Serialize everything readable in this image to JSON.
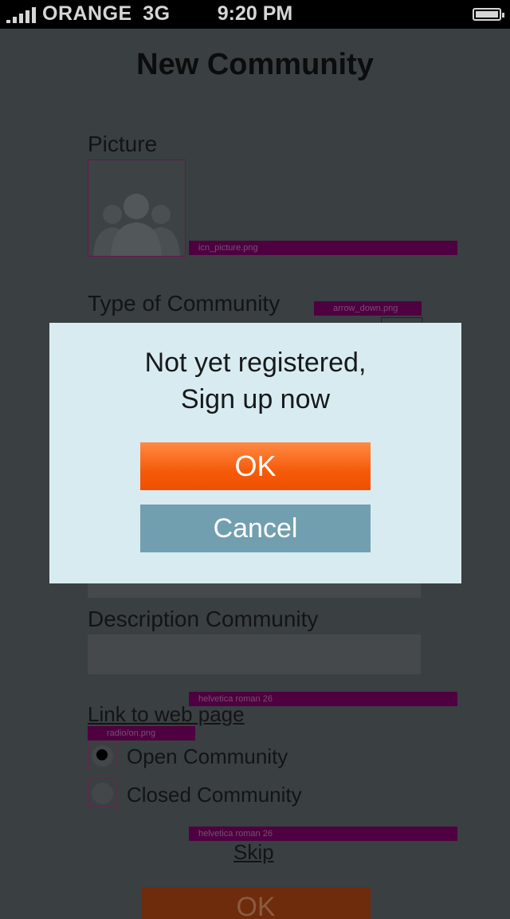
{
  "status_bar": {
    "carrier": "ORANGE",
    "network": "3G",
    "time": "9:20 PM"
  },
  "page": {
    "title": "New Community",
    "picture_label": "Picture",
    "type_label": "Type of Community",
    "description_label": "Description Community",
    "link_label": "Link to web page",
    "radio_options": [
      {
        "label": "Open Community",
        "selected": true
      },
      {
        "label": "Closed Community",
        "selected": false
      }
    ],
    "skip_label": "Skip",
    "ok_label": "OK"
  },
  "annotations": {
    "picture": "icn_picture.png",
    "arrow": "arrow_down.png",
    "font_link": "helvetica roman 26",
    "radio": "radio/on.png",
    "font_skip": "helvetica roman 26"
  },
  "dialog": {
    "message_line1": "Not yet registered,",
    "message_line2": "Sign up now",
    "ok_label": "OK",
    "cancel_label": "Cancel"
  },
  "colors": {
    "overlay_background": "#3a3f42",
    "dialog_background": "#d8ebf1",
    "ok_button": "#f55b0a",
    "cancel_button": "#729fb0",
    "annotation_tag": "#4e0040"
  }
}
